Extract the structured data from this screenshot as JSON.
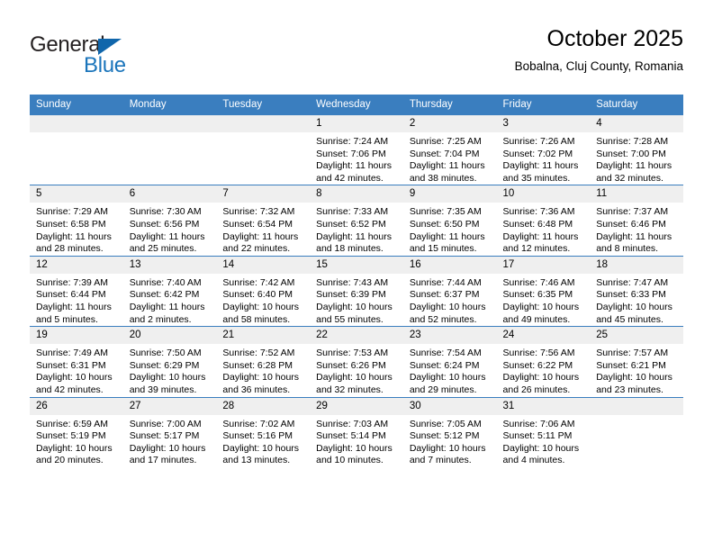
{
  "brand": {
    "name_part1": "General",
    "name_part2": "Blue",
    "triangle_icon": "triangle-icon",
    "accent_color": "#1b75bb"
  },
  "header": {
    "title": "October 2025",
    "subtitle": "Bobalna, Cluj County, Romania"
  },
  "theme": {
    "header_bg": "#3a7ebf",
    "daynum_bg": "#efefef",
    "text": "#000000"
  },
  "calendar": {
    "weekday_headers": [
      "Sunday",
      "Monday",
      "Tuesday",
      "Wednesday",
      "Thursday",
      "Friday",
      "Saturday"
    ],
    "weeks": [
      [
        {
          "day": "",
          "sunrise": "",
          "sunset": "",
          "daylight_line1": "",
          "daylight_line2": ""
        },
        {
          "day": "",
          "sunrise": "",
          "sunset": "",
          "daylight_line1": "",
          "daylight_line2": ""
        },
        {
          "day": "",
          "sunrise": "",
          "sunset": "",
          "daylight_line1": "",
          "daylight_line2": ""
        },
        {
          "day": "1",
          "sunrise": "Sunrise: 7:24 AM",
          "sunset": "Sunset: 7:06 PM",
          "daylight_line1": "Daylight: 11 hours",
          "daylight_line2": "and 42 minutes."
        },
        {
          "day": "2",
          "sunrise": "Sunrise: 7:25 AM",
          "sunset": "Sunset: 7:04 PM",
          "daylight_line1": "Daylight: 11 hours",
          "daylight_line2": "and 38 minutes."
        },
        {
          "day": "3",
          "sunrise": "Sunrise: 7:26 AM",
          "sunset": "Sunset: 7:02 PM",
          "daylight_line1": "Daylight: 11 hours",
          "daylight_line2": "and 35 minutes."
        },
        {
          "day": "4",
          "sunrise": "Sunrise: 7:28 AM",
          "sunset": "Sunset: 7:00 PM",
          "daylight_line1": "Daylight: 11 hours",
          "daylight_line2": "and 32 minutes."
        }
      ],
      [
        {
          "day": "5",
          "sunrise": "Sunrise: 7:29 AM",
          "sunset": "Sunset: 6:58 PM",
          "daylight_line1": "Daylight: 11 hours",
          "daylight_line2": "and 28 minutes."
        },
        {
          "day": "6",
          "sunrise": "Sunrise: 7:30 AM",
          "sunset": "Sunset: 6:56 PM",
          "daylight_line1": "Daylight: 11 hours",
          "daylight_line2": "and 25 minutes."
        },
        {
          "day": "7",
          "sunrise": "Sunrise: 7:32 AM",
          "sunset": "Sunset: 6:54 PM",
          "daylight_line1": "Daylight: 11 hours",
          "daylight_line2": "and 22 minutes."
        },
        {
          "day": "8",
          "sunrise": "Sunrise: 7:33 AM",
          "sunset": "Sunset: 6:52 PM",
          "daylight_line1": "Daylight: 11 hours",
          "daylight_line2": "and 18 minutes."
        },
        {
          "day": "9",
          "sunrise": "Sunrise: 7:35 AM",
          "sunset": "Sunset: 6:50 PM",
          "daylight_line1": "Daylight: 11 hours",
          "daylight_line2": "and 15 minutes."
        },
        {
          "day": "10",
          "sunrise": "Sunrise: 7:36 AM",
          "sunset": "Sunset: 6:48 PM",
          "daylight_line1": "Daylight: 11 hours",
          "daylight_line2": "and 12 minutes."
        },
        {
          "day": "11",
          "sunrise": "Sunrise: 7:37 AM",
          "sunset": "Sunset: 6:46 PM",
          "daylight_line1": "Daylight: 11 hours",
          "daylight_line2": "and 8 minutes."
        }
      ],
      [
        {
          "day": "12",
          "sunrise": "Sunrise: 7:39 AM",
          "sunset": "Sunset: 6:44 PM",
          "daylight_line1": "Daylight: 11 hours",
          "daylight_line2": "and 5 minutes."
        },
        {
          "day": "13",
          "sunrise": "Sunrise: 7:40 AM",
          "sunset": "Sunset: 6:42 PM",
          "daylight_line1": "Daylight: 11 hours",
          "daylight_line2": "and 2 minutes."
        },
        {
          "day": "14",
          "sunrise": "Sunrise: 7:42 AM",
          "sunset": "Sunset: 6:40 PM",
          "daylight_line1": "Daylight: 10 hours",
          "daylight_line2": "and 58 minutes."
        },
        {
          "day": "15",
          "sunrise": "Sunrise: 7:43 AM",
          "sunset": "Sunset: 6:39 PM",
          "daylight_line1": "Daylight: 10 hours",
          "daylight_line2": "and 55 minutes."
        },
        {
          "day": "16",
          "sunrise": "Sunrise: 7:44 AM",
          "sunset": "Sunset: 6:37 PM",
          "daylight_line1": "Daylight: 10 hours",
          "daylight_line2": "and 52 minutes."
        },
        {
          "day": "17",
          "sunrise": "Sunrise: 7:46 AM",
          "sunset": "Sunset: 6:35 PM",
          "daylight_line1": "Daylight: 10 hours",
          "daylight_line2": "and 49 minutes."
        },
        {
          "day": "18",
          "sunrise": "Sunrise: 7:47 AM",
          "sunset": "Sunset: 6:33 PM",
          "daylight_line1": "Daylight: 10 hours",
          "daylight_line2": "and 45 minutes."
        }
      ],
      [
        {
          "day": "19",
          "sunrise": "Sunrise: 7:49 AM",
          "sunset": "Sunset: 6:31 PM",
          "daylight_line1": "Daylight: 10 hours",
          "daylight_line2": "and 42 minutes."
        },
        {
          "day": "20",
          "sunrise": "Sunrise: 7:50 AM",
          "sunset": "Sunset: 6:29 PM",
          "daylight_line1": "Daylight: 10 hours",
          "daylight_line2": "and 39 minutes."
        },
        {
          "day": "21",
          "sunrise": "Sunrise: 7:52 AM",
          "sunset": "Sunset: 6:28 PM",
          "daylight_line1": "Daylight: 10 hours",
          "daylight_line2": "and 36 minutes."
        },
        {
          "day": "22",
          "sunrise": "Sunrise: 7:53 AM",
          "sunset": "Sunset: 6:26 PM",
          "daylight_line1": "Daylight: 10 hours",
          "daylight_line2": "and 32 minutes."
        },
        {
          "day": "23",
          "sunrise": "Sunrise: 7:54 AM",
          "sunset": "Sunset: 6:24 PM",
          "daylight_line1": "Daylight: 10 hours",
          "daylight_line2": "and 29 minutes."
        },
        {
          "day": "24",
          "sunrise": "Sunrise: 7:56 AM",
          "sunset": "Sunset: 6:22 PM",
          "daylight_line1": "Daylight: 10 hours",
          "daylight_line2": "and 26 minutes."
        },
        {
          "day": "25",
          "sunrise": "Sunrise: 7:57 AM",
          "sunset": "Sunset: 6:21 PM",
          "daylight_line1": "Daylight: 10 hours",
          "daylight_line2": "and 23 minutes."
        }
      ],
      [
        {
          "day": "26",
          "sunrise": "Sunrise: 6:59 AM",
          "sunset": "Sunset: 5:19 PM",
          "daylight_line1": "Daylight: 10 hours",
          "daylight_line2": "and 20 minutes."
        },
        {
          "day": "27",
          "sunrise": "Sunrise: 7:00 AM",
          "sunset": "Sunset: 5:17 PM",
          "daylight_line1": "Daylight: 10 hours",
          "daylight_line2": "and 17 minutes."
        },
        {
          "day": "28",
          "sunrise": "Sunrise: 7:02 AM",
          "sunset": "Sunset: 5:16 PM",
          "daylight_line1": "Daylight: 10 hours",
          "daylight_line2": "and 13 minutes."
        },
        {
          "day": "29",
          "sunrise": "Sunrise: 7:03 AM",
          "sunset": "Sunset: 5:14 PM",
          "daylight_line1": "Daylight: 10 hours",
          "daylight_line2": "and 10 minutes."
        },
        {
          "day": "30",
          "sunrise": "Sunrise: 7:05 AM",
          "sunset": "Sunset: 5:12 PM",
          "daylight_line1": "Daylight: 10 hours",
          "daylight_line2": "and 7 minutes."
        },
        {
          "day": "31",
          "sunrise": "Sunrise: 7:06 AM",
          "sunset": "Sunset: 5:11 PM",
          "daylight_line1": "Daylight: 10 hours",
          "daylight_line2": "and 4 minutes."
        },
        {
          "day": "",
          "sunrise": "",
          "sunset": "",
          "daylight_line1": "",
          "daylight_line2": ""
        }
      ]
    ]
  }
}
